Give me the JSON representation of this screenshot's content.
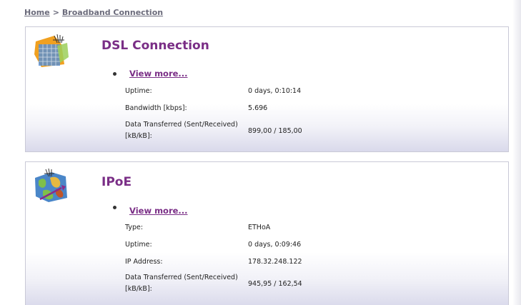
{
  "breadcrumb": {
    "home": "Home",
    "separator": ">",
    "current": "Broadband Connection"
  },
  "dsl": {
    "title": "DSL Connection",
    "view_more": "View more...",
    "icon": "dsl-network-icon",
    "rows": [
      {
        "label": "Uptime:",
        "value": "0 days, 0:10:14"
      },
      {
        "label": "Bandwidth [kbps]:",
        "value": "5.696"
      },
      {
        "label": "Data Transferred (Sent/Received) [kB/kB]:",
        "value": "899,00 / 185,00"
      }
    ]
  },
  "ipoe": {
    "title": "IPoE",
    "view_more": "View more...",
    "icon": "ipoe-globe-icon",
    "rows": [
      {
        "label": "Type:",
        "value": "ETHoA"
      },
      {
        "label": "Uptime:",
        "value": "0 days, 0:09:46"
      },
      {
        "label": "IP Address:",
        "value": "178.32.248.122"
      },
      {
        "label": "Data Transferred (Sent/Received) [kB/kB]:",
        "value": "945,95 / 162,54"
      }
    ]
  },
  "colors": {
    "accent": "#7a2e86",
    "border": "#c9c9d6",
    "breadcrumb": "#6b6b7b"
  }
}
